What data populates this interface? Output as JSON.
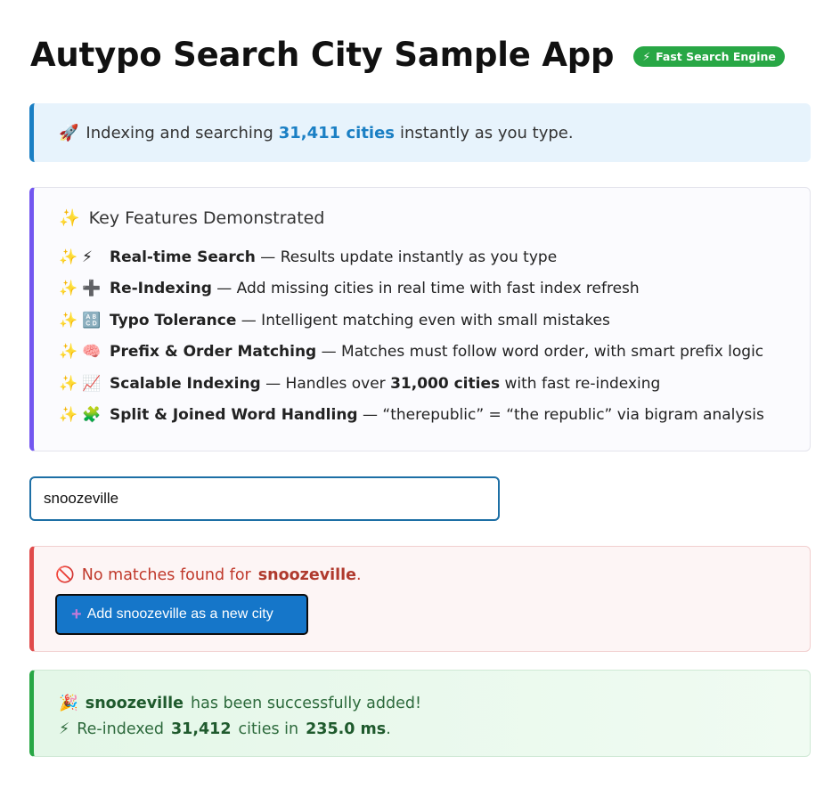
{
  "header": {
    "title": "Autypo Search City Sample App",
    "badge_icon": "⚡",
    "badge_label": "Fast Search Engine"
  },
  "info": {
    "icon": "🚀",
    "prefix": "Indexing and searching",
    "count": "31,411 cities",
    "suffix": "instantly as you type."
  },
  "features": {
    "title_icon": "✨",
    "title": "Key Features Demonstrated",
    "items": [
      {
        "icon": "⚡",
        "name": "Real-time Search",
        "desc": " — Results update instantly as you type"
      },
      {
        "icon": "➕",
        "name": "Re-Indexing",
        "desc": " — Add missing cities in real time with fast index refresh"
      },
      {
        "icon": "🔠",
        "name": "Typo Tolerance",
        "desc": " — Intelligent matching even with small mistakes"
      },
      {
        "icon": "🧠",
        "name": "Prefix & Order Matching",
        "desc": " — Matches must follow word order, with smart prefix logic"
      },
      {
        "icon": "📈",
        "name": "Scalable Indexing",
        "desc": " — Handles over ",
        "bold_extra": "31,000 cities",
        "desc_after": " with fast re-indexing"
      },
      {
        "icon": "🧩",
        "name": "Split & Joined Word Handling",
        "desc": " — “therepublic” = “the republic” via bigram analysis"
      }
    ]
  },
  "search": {
    "value": "snoozeville"
  },
  "no_match": {
    "icon": "🚫",
    "prefix": "No matches found for",
    "term": "snoozeville",
    "suffix": ".",
    "button_icon": "+",
    "button_label": "Add snoozeville as a new city"
  },
  "success": {
    "line1_icon": "🎉",
    "city": "snoozeville",
    "line1_suffix": "has been successfully added!",
    "line2_icon": "⚡",
    "line2_prefix": "Re-indexed",
    "count": "31,412",
    "line2_mid": "cities in",
    "time": "235.0 ms",
    "line2_suffix": "."
  },
  "colors": {
    "accent": "#1a7fc4",
    "success": "#28a745",
    "error": "#e04b4b",
    "feature_border": "#7357f0"
  }
}
